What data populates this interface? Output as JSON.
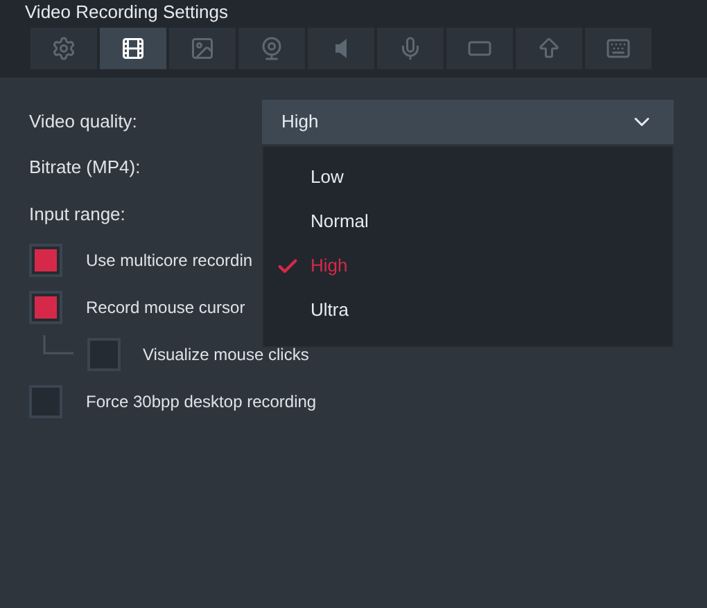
{
  "window": {
    "title": "Video Recording Settings"
  },
  "tabs": [
    {
      "kind": "general",
      "selected": false
    },
    {
      "kind": "video",
      "selected": true
    },
    {
      "kind": "image",
      "selected": false
    },
    {
      "kind": "webcam",
      "selected": false
    },
    {
      "kind": "audio",
      "selected": false
    },
    {
      "kind": "microphone",
      "selected": false
    },
    {
      "kind": "window",
      "selected": false
    },
    {
      "kind": "upload",
      "selected": false
    },
    {
      "kind": "keyboard",
      "selected": false
    }
  ],
  "fields": [
    {
      "label": "Video quality:",
      "value": "High",
      "expanded": true
    },
    {
      "label": "Bitrate (MP4):"
    },
    {
      "label": "Input range:"
    }
  ],
  "dropdown_options": [
    {
      "label": "Low",
      "selected": false
    },
    {
      "label": "Normal",
      "selected": false
    },
    {
      "label": "High",
      "selected": true
    },
    {
      "label": "Ultra",
      "selected": false
    }
  ],
  "checkboxes": [
    {
      "label": "Use multicore recordin",
      "checked": true
    },
    {
      "label": "Record mouse cursor",
      "checked": true,
      "children": [
        {
          "label": "Visualize mouse clicks",
          "checked": false
        }
      ]
    },
    {
      "label": "Force 30bpp desktop recording",
      "checked": false
    }
  ]
}
